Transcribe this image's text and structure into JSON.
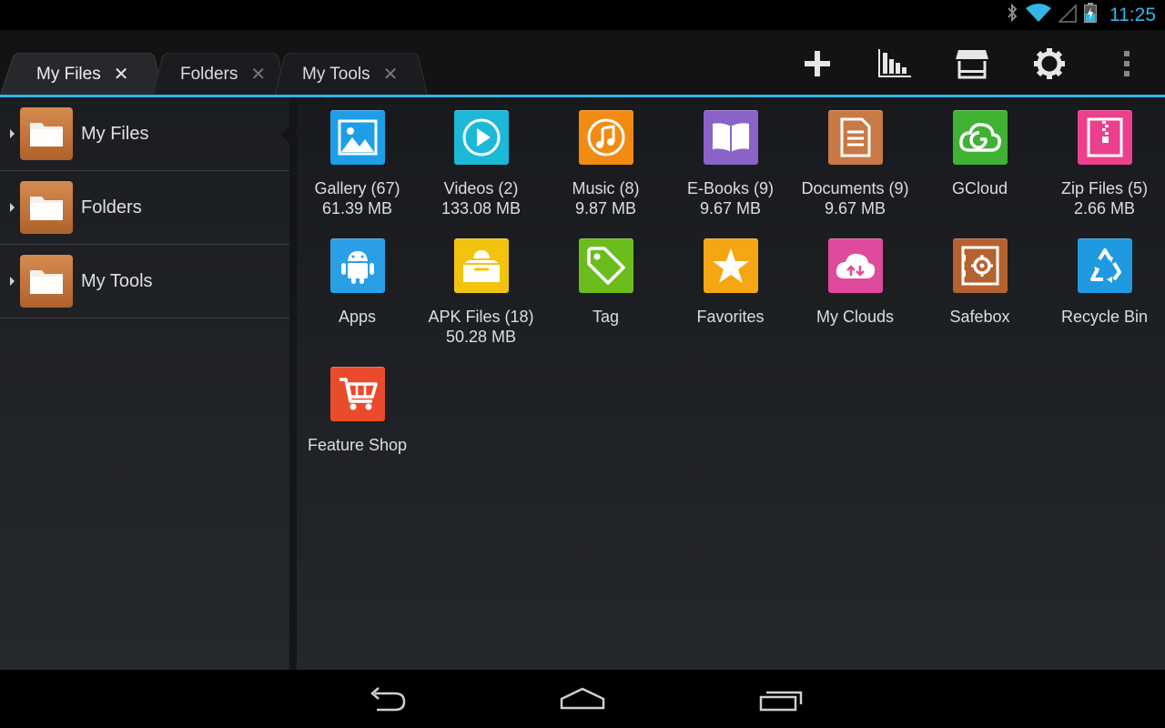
{
  "status_bar": {
    "time": "11:25",
    "icons": [
      "bluetooth-icon",
      "wifi-icon",
      "signal-icon",
      "battery-charging-icon"
    ]
  },
  "tabs": [
    {
      "label": "My Files",
      "close": "✕",
      "active": true
    },
    {
      "label": "Folders",
      "close": "✕",
      "active": false
    },
    {
      "label": "My Tools",
      "close": "✕",
      "active": false
    }
  ],
  "action_bar": {
    "icons": [
      "add-icon",
      "analyze-chart-icon",
      "store-icon",
      "settings-icon",
      "overflow-menu-icon"
    ]
  },
  "sidebar": {
    "items": [
      {
        "label": "My Files",
        "selected": true
      },
      {
        "label": "Folders",
        "selected": false
      },
      {
        "label": "My Tools",
        "selected": false
      }
    ]
  },
  "grid": {
    "items": [
      {
        "label": "Gallery (67)",
        "size": "61.39 MB",
        "icon": "gallery-icon",
        "color": "#1e9ee6"
      },
      {
        "label": "Videos (2)",
        "size": "133.08 MB",
        "icon": "video-play-icon",
        "color": "#1cb8d8"
      },
      {
        "label": "Music (8)",
        "size": "9.87 MB",
        "icon": "music-note-icon",
        "color": "#f28b12"
      },
      {
        "label": "E-Books (9)",
        "size": "9.67 MB",
        "icon": "book-icon",
        "color": "#8a63c9"
      },
      {
        "label": "Documents (9)",
        "size": "9.67 MB",
        "icon": "document-icon",
        "color": "#c77a45"
      },
      {
        "label": "GCloud",
        "size": "",
        "icon": "gcloud-icon",
        "color": "#3fb234"
      },
      {
        "label": "Zip Files (5)",
        "size": "2.66 MB",
        "icon": "zip-icon",
        "color": "#ec3f8e"
      },
      {
        "label": "Apps",
        "size": "",
        "icon": "android-icon",
        "color": "#2a9ee6"
      },
      {
        "label": "APK Files (18)",
        "size": "50.28 MB",
        "icon": "apk-box-icon",
        "color": "#f2c40f"
      },
      {
        "label": "Tag",
        "size": "",
        "icon": "tag-icon",
        "color": "#6bbd1e"
      },
      {
        "label": "Favorites",
        "size": "",
        "icon": "star-icon",
        "color": "#f4a712"
      },
      {
        "label": "My Clouds",
        "size": "",
        "icon": "cloud-upload-icon",
        "color": "#e04a9c"
      },
      {
        "label": "Safebox",
        "size": "",
        "icon": "safebox-icon",
        "color": "#b56230"
      },
      {
        "label": "Recycle Bin",
        "size": "",
        "icon": "recycle-icon",
        "color": "#1f99e0"
      },
      {
        "label": "Feature Shop",
        "size": "",
        "icon": "shopping-cart-icon",
        "color": "#ea4b2c"
      }
    ]
  },
  "nav_bar": {
    "icons": [
      "back-icon",
      "home-icon",
      "recent-apps-icon"
    ]
  }
}
